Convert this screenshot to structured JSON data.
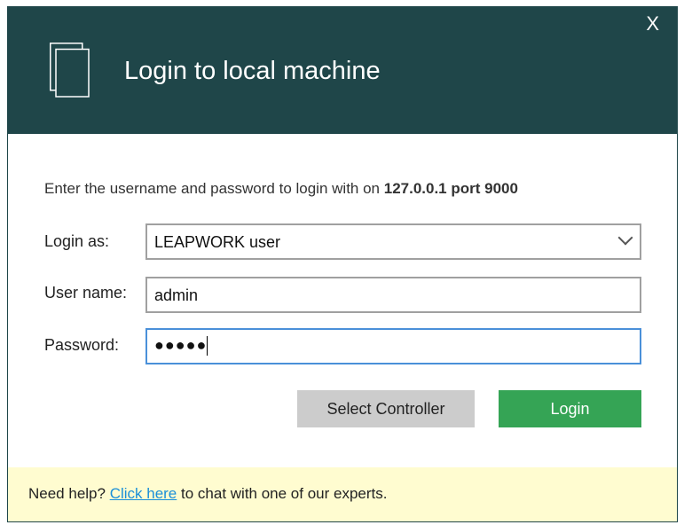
{
  "dialog": {
    "title": "Login to local machine",
    "close_label": "X"
  },
  "intro": {
    "text": "Enter the username and password to login with on ",
    "host": "127.0.0.1 port 9000"
  },
  "form": {
    "login_as": {
      "label": "Login as:",
      "value": "LEAPWORK user"
    },
    "username": {
      "label": "User name:",
      "value": "admin"
    },
    "password": {
      "label": "Password:",
      "value": "●●●●●"
    }
  },
  "buttons": {
    "select_controller": "Select Controller",
    "login": "Login"
  },
  "footer": {
    "prefix": "Need help? ",
    "link": "Click here",
    "suffix": " to chat with one of our experts."
  },
  "colors": {
    "header": "#1f4649",
    "login": "#35a455",
    "footer": "#fffcd0",
    "link": "#1a8fd8"
  }
}
